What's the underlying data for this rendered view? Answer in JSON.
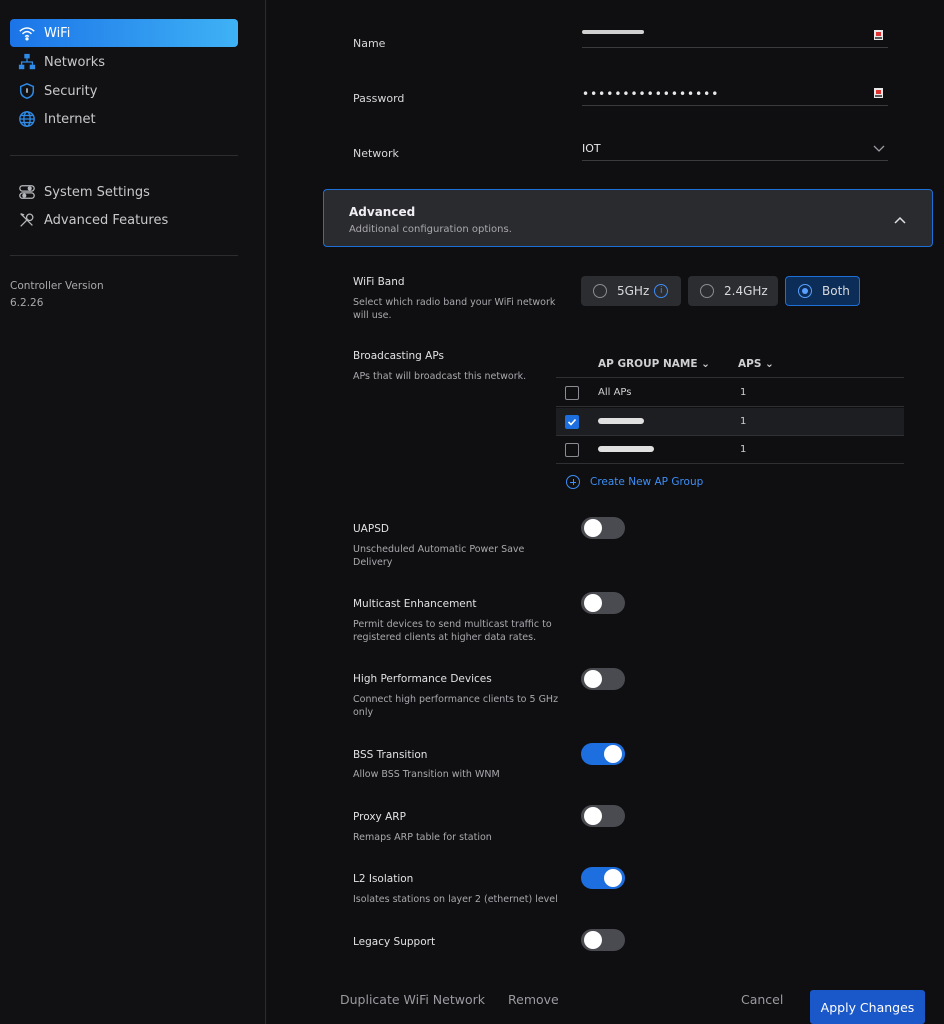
{
  "sidebar": {
    "items": [
      {
        "label": "WiFi",
        "icon": "wifi-icon",
        "active": true
      },
      {
        "label": "Networks",
        "icon": "networks-icon"
      },
      {
        "label": "Security",
        "icon": "shield-icon"
      },
      {
        "label": "Internet",
        "icon": "globe-icon"
      },
      {
        "label": "System Settings",
        "icon": "toggles-icon"
      },
      {
        "label": "Advanced Features",
        "icon": "tools-icon"
      }
    ],
    "version_label": "Controller Version",
    "version_value": "6.2.26"
  },
  "form": {
    "name_label": "Name",
    "password_label": "Password",
    "password_mask": "•••••••••••••••••",
    "network_label": "Network",
    "network_value": "IOT"
  },
  "advanced": {
    "title": "Advanced",
    "subtitle": "Additional configuration options."
  },
  "wifi_band": {
    "title": "WiFi Band",
    "description": "Select which radio band your WiFi network will use.",
    "options": [
      "5GHz",
      "2.4GHz",
      "Both"
    ],
    "selected": "Both"
  },
  "broadcasting": {
    "title": "Broadcasting APs",
    "description": "APs that will broadcast this network.",
    "col_group": "AP GROUP NAME",
    "col_aps": "APS",
    "rows": [
      {
        "name": "All APs",
        "aps": "1",
        "checked": false
      },
      {
        "name": "",
        "aps": "1",
        "checked": true
      },
      {
        "name": "",
        "aps": "1",
        "checked": false
      }
    ],
    "create_link": "Create New AP Group"
  },
  "settings": [
    {
      "title": "UAPSD",
      "description": "Unscheduled Automatic Power Save Delivery",
      "enabled": false
    },
    {
      "title": "Multicast Enhancement",
      "description": "Permit devices to send multicast traffic to registered clients at higher data rates.",
      "enabled": false
    },
    {
      "title": "High Performance Devices",
      "description": "Connect high performance clients to 5 GHz only",
      "enabled": false
    },
    {
      "title": "BSS Transition",
      "description": "Allow BSS Transition with WNM",
      "enabled": true
    },
    {
      "title": "Proxy ARP",
      "description": "Remaps ARP table for station",
      "enabled": false
    },
    {
      "title": "L2 Isolation",
      "description": "Isolates stations on layer 2 (ethernet) level",
      "enabled": true
    },
    {
      "title": "Legacy Support",
      "description": "",
      "enabled": false
    }
  ],
  "footer": {
    "duplicate": "Duplicate WiFi Network",
    "remove": "Remove",
    "cancel": "Cancel",
    "apply": "Apply Changes"
  },
  "colors": {
    "accent": "#1d6fe0",
    "background": "#111113"
  }
}
